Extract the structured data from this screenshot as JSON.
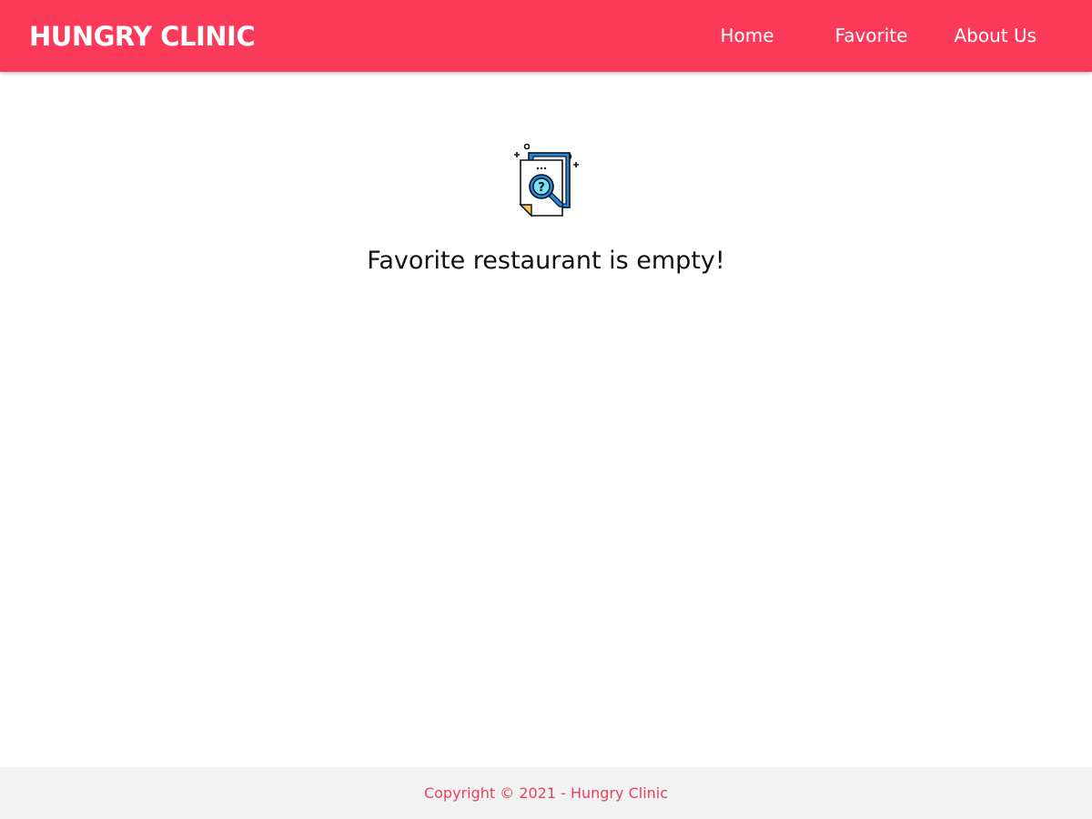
{
  "header": {
    "brand": "HUNGRY CLINIC",
    "nav": [
      {
        "label": "Home"
      },
      {
        "label": "Favorite"
      },
      {
        "label": "About Us"
      }
    ],
    "background_color": "#fb3a5a"
  },
  "main": {
    "illustration_icon": "document-search-question-icon",
    "empty_message": "Favorite restaurant is empty!"
  },
  "footer": {
    "copyright": "Copyright © 2021 - Hungry Clinic",
    "text_color": "#e8435e",
    "background_color": "#f2f2f2"
  }
}
